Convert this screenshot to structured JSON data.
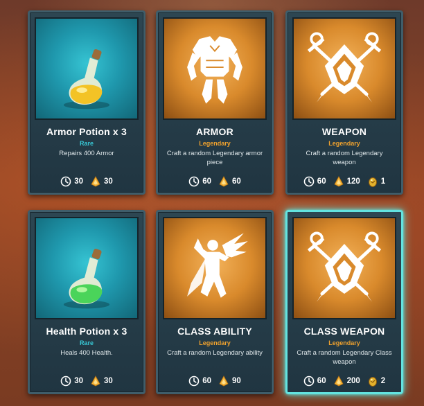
{
  "cards": [
    {
      "title": "Armor Potion x 3",
      "rarity": "Rare",
      "description": "Repairs 400 Armor",
      "art_icon": "potion-yellow-icon",
      "costs": {
        "time": "30",
        "gold": "30"
      }
    },
    {
      "title": "ARMOR",
      "rarity": "Legendary",
      "description": "Craft a random Legendary armor piece",
      "art_icon": "armor-icon",
      "costs": {
        "time": "60",
        "gold": "60"
      }
    },
    {
      "title": "WEAPON",
      "rarity": "Legendary",
      "description": "Craft a random Legendary weapon",
      "art_icon": "crossed-swords-shield-icon",
      "costs": {
        "time": "60",
        "gold": "120",
        "egg": "1"
      }
    },
    {
      "title": "Health Potion x 3",
      "rarity": "Rare",
      "description": "Heals 400 Health.",
      "art_icon": "potion-green-icon",
      "costs": {
        "time": "30",
        "gold": "30"
      }
    },
    {
      "title": "CLASS ABILITY",
      "rarity": "Legendary",
      "description": "Craft a random Legendary ability",
      "art_icon": "winged-hero-icon",
      "costs": {
        "time": "60",
        "gold": "90"
      }
    },
    {
      "title": "CLASS WEAPON",
      "rarity": "Legendary",
      "description": "Craft a random Legendary Class weapon",
      "art_icon": "crossed-swords-shield-icon",
      "costs": {
        "time": "60",
        "gold": "200",
        "egg": "2"
      }
    }
  ],
  "selected_card": "CLASS WEAPON",
  "colors": {
    "rare": "#38c8d6",
    "legendary": "#f0a22e",
    "selected_glow": "#63e3e0"
  }
}
